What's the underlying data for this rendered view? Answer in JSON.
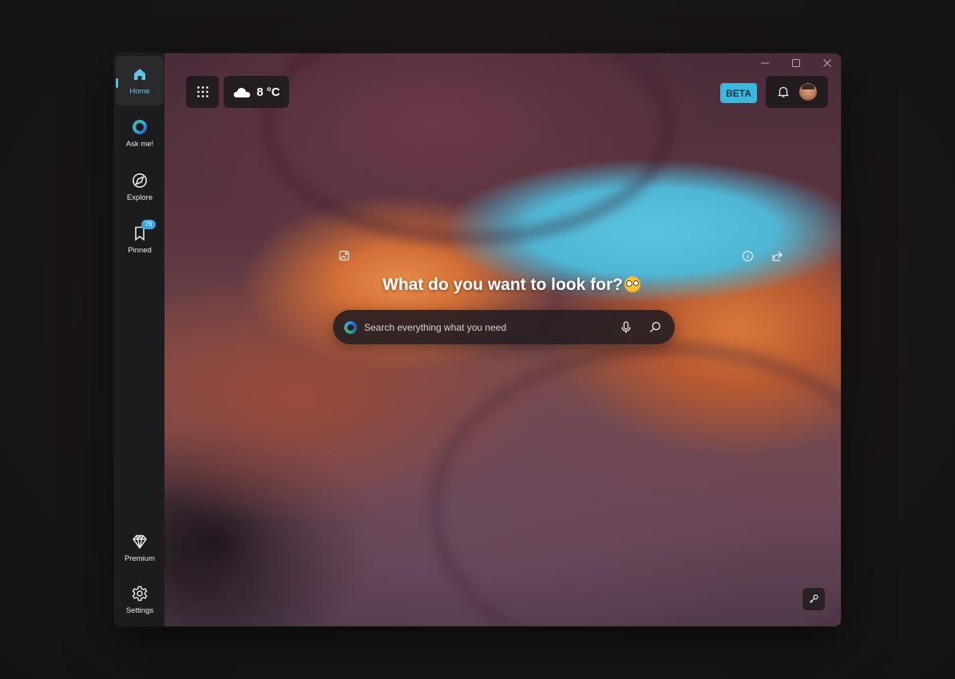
{
  "sidebar": {
    "items": [
      {
        "label": "Home",
        "icon": "home-icon",
        "active": true
      },
      {
        "label": "Ask me!",
        "icon": "assistant-orb-icon"
      },
      {
        "label": "Explore",
        "icon": "compass-icon"
      },
      {
        "label": "Pinned",
        "icon": "bookmark-icon",
        "badge": "76"
      },
      {
        "label": "Premium",
        "icon": "diamond-icon"
      },
      {
        "label": "Settings",
        "icon": "gear-icon"
      }
    ]
  },
  "header": {
    "apps_icon": "apps-grid-icon",
    "weather": {
      "temperature": "8 °C",
      "icon": "cloud-icon"
    },
    "beta_label": "BETA",
    "notifications_icon": "bell-icon",
    "avatar_icon": "user-avatar"
  },
  "window_controls": [
    "minimize-icon",
    "maximize-icon",
    "close-icon"
  ],
  "main": {
    "headline": "What do you want to look for?",
    "search": {
      "placeholder": "Search everything what you need"
    },
    "floating_icons": [
      "image-icon",
      "info-icon",
      "share-icon"
    ],
    "corner_button_icon": "puzzle-link-icon"
  },
  "colors": {
    "accent": "#3bb8e0",
    "sidebar_bg": "#1c1b1d",
    "badge": "#3aa6e6"
  }
}
